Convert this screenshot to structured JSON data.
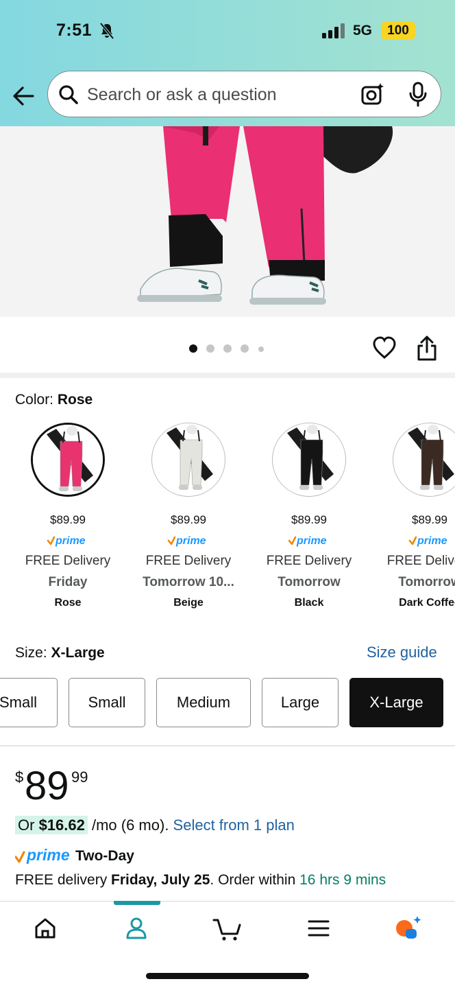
{
  "status_bar": {
    "time": "7:51",
    "network": "5G",
    "battery": "100"
  },
  "search": {
    "placeholder": "Search or ask a question"
  },
  "gallery": {
    "page_count": 5,
    "current_page": 1
  },
  "color": {
    "label": "Color:",
    "selected": "Rose",
    "options": [
      {
        "price": "$89.99",
        "prime": "prime",
        "free": "FREE Delivery",
        "when": "Friday",
        "name": "Rose",
        "color": "#e8336f",
        "selected": true
      },
      {
        "price": "$89.99",
        "prime": "prime",
        "free": "FREE Delivery",
        "when": "Tomorrow 10...",
        "name": "Beige",
        "color": "#e4e4df",
        "selected": false
      },
      {
        "price": "$89.99",
        "prime": "prime",
        "free": "FREE Delivery",
        "when": "Tomorrow",
        "name": "Black",
        "color": "#151515",
        "selected": false
      },
      {
        "price": "$89.99",
        "prime": "prime",
        "free": "FREE Delivery",
        "when": "Tomorrow",
        "name": "Dark Coffee",
        "color": "#3a2a22",
        "selected": false
      }
    ]
  },
  "size": {
    "label": "Size:",
    "selected": "X-Large",
    "guide": "Size guide",
    "options": [
      "Small",
      "Small",
      "Medium",
      "Large",
      "X-Large"
    ]
  },
  "price": {
    "symbol": "$",
    "whole": "89",
    "fraction": "99",
    "monthly_prefix": "Or ",
    "monthly_amount": "$16.62",
    "monthly_suffix": " /mo (6 mo). ",
    "plan_link": "Select from 1 plan"
  },
  "delivery": {
    "prime": "prime",
    "speed": "Two-Day",
    "prefix": "FREE delivery ",
    "date": "Friday, July 25",
    "middle": ". Order within ",
    "countdown": "16 hrs 9 mins"
  },
  "colors": {
    "link": "#2162a1",
    "prime_blue": "#1a98ff",
    "prime_check": "#f08804",
    "green": "#067d62",
    "product": "#e8336f"
  }
}
